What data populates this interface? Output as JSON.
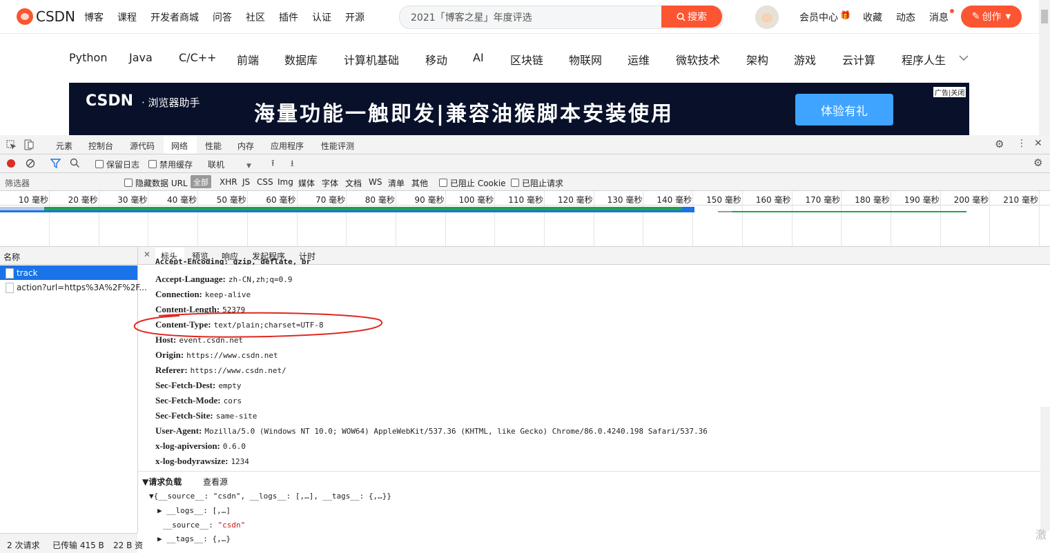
{
  "topnav": {
    "logo": "CSDN",
    "links": [
      "博客",
      "课程",
      "开发者商城",
      "问答",
      "社区",
      "插件",
      "认证",
      "开源"
    ],
    "search_placeholder": "2021「博客之星」年度评选",
    "search_button": "搜索",
    "right_links": [
      "会员中心",
      "收藏",
      "动态",
      "消息"
    ],
    "create_button": "创作"
  },
  "categories": [
    "Python",
    "Java",
    "C/C++",
    "前端",
    "数据库",
    "计算机基础",
    "移动",
    "AI",
    "区块链",
    "物联网",
    "运维",
    "微软技术",
    "架构",
    "游戏",
    "云计算",
    "程序人生"
  ],
  "banner": {
    "logo": "CSDN",
    "subtitle": "· 浏览器助手",
    "headline": "海量功能一触即发|兼容油猴脚本安装使用",
    "button": "体验有礼",
    "ad_label": "广告|关闭"
  },
  "devtools": {
    "tabs": [
      "元素",
      "控制台",
      "源代码",
      "网络",
      "性能",
      "内存",
      "应用程序",
      "性能评测"
    ],
    "active_tab": "网络",
    "toolbar": {
      "preserve_log": "保留日志",
      "disable_cache": "禁用缓存",
      "throttle": "联机"
    },
    "filter": {
      "placeholder": "筛选器",
      "hide_data_urls": "隐藏数据 URL",
      "all": "全部",
      "types": [
        "XHR",
        "JS",
        "CSS",
        "Img",
        "媒体",
        "字体",
        "文档",
        "WS",
        "清单",
        "其他"
      ],
      "blocked_cookies": "已阻止 Cookie",
      "blocked_requests": "已阻止请求"
    },
    "timeline_ticks": [
      "10 毫秒",
      "20 毫秒",
      "30 毫秒",
      "40 毫秒",
      "50 毫秒",
      "60 毫秒",
      "70 毫秒",
      "80 毫秒",
      "90 毫秒",
      "100 毫秒",
      "110 毫秒",
      "120 毫秒",
      "130 毫秒",
      "140 毫秒",
      "150 毫秒",
      "160 毫秒",
      "170 毫秒",
      "180 毫秒",
      "190 毫秒",
      "200 毫秒",
      "210 毫秒"
    ],
    "requests": {
      "header": "名称",
      "items": [
        "track",
        "action?url=https%3A%2F%2F..."
      ],
      "selected": "track"
    },
    "status": {
      "requests": "2 次请求",
      "transferred": "已传输 415 B",
      "resources": "22 B 资"
    },
    "detail_tabs": [
      "标头",
      "预览",
      "响应",
      "发起程序",
      "计时"
    ],
    "active_detail_tab": "标头",
    "headers": [
      {
        "k": "Accept-Language:",
        "v": "zh-CN,zh;q=0.9"
      },
      {
        "k": "Connection:",
        "v": "keep-alive"
      },
      {
        "k": "Content-Length:",
        "v": "52379"
      },
      {
        "k": "Content-Type:",
        "v": "text/plain;charset=UTF-8"
      },
      {
        "k": "Host:",
        "v": "event.csdn.net"
      },
      {
        "k": "Origin:",
        "v": "https://www.csdn.net"
      },
      {
        "k": "Referer:",
        "v": "https://www.csdn.net/"
      },
      {
        "k": "Sec-Fetch-Dest:",
        "v": "empty"
      },
      {
        "k": "Sec-Fetch-Mode:",
        "v": "cors"
      },
      {
        "k": "Sec-Fetch-Site:",
        "v": "same-site"
      },
      {
        "k": "User-Agent:",
        "v": "Mozilla/5.0 (Windows NT 10.0; WOW64) AppleWebKit/537.36 (KHTML, like Gecko) Chrome/86.0.4240.198 Safari/537.36"
      },
      {
        "k": "x-log-apiversion:",
        "v": "0.6.0"
      },
      {
        "k": "x-log-bodyrawsize:",
        "v": "1234"
      }
    ],
    "cut_off_header": "Accept-Encoding: gzip, deflate, br",
    "payload": {
      "title": "▼请求负载",
      "view_source": "查看源",
      "root": "▼{__source__: \"csdn\", __logs__: [,…], __tags__: {,…}}",
      "logs": "▶ __logs__: [,…]",
      "source_key": "__source__:",
      "source_val": "\"csdn\"",
      "tags": "▶ __tags__: {,…}"
    }
  },
  "watermark": "激"
}
